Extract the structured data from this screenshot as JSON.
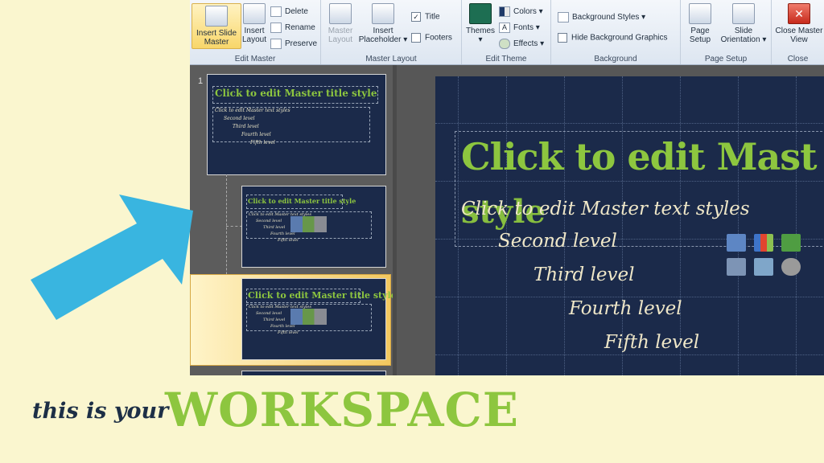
{
  "ribbon": {
    "groups": {
      "edit_master": "Edit Master",
      "master_layout": "Master Layout",
      "edit_theme": "Edit Theme",
      "background": "Background",
      "page_setup": "Page Setup",
      "close": "Close"
    },
    "insert_slide_master": "Insert Slide Master",
    "insert_layout": "Insert Layout",
    "delete": "Delete",
    "rename": "Rename",
    "preserve": "Preserve",
    "master_layout_btn": "Master Layout",
    "insert_placeholder": "Insert Placeholder",
    "title_chk": "Title",
    "footers_chk": "Footers",
    "themes": "Themes",
    "colors": "Colors",
    "fonts": "Fonts",
    "effects": "Effects",
    "background_styles": "Background Styles",
    "hide_background_graphics": "Hide Background Graphics",
    "page_setup_btn": "Page Setup",
    "slide_orientation": "Slide Orientation",
    "close_master_view": "Close Master View"
  },
  "thumbnails": {
    "number": "1",
    "master_title": "Click to edit Master title style",
    "text_lines": [
      "Click to edit Master text styles",
      "Second level",
      "Third level",
      "Fourth level",
      "Fifth level"
    ]
  },
  "slide": {
    "title_line1": "Click to edit Mast",
    "title_line2": "style",
    "levels": [
      "Click to edit Master text styles",
      "Second level",
      "Third level",
      "Fourth level",
      "Fifth level"
    ]
  },
  "caption": {
    "lead": "this is your",
    "emphasis": "WORKSPACE"
  },
  "colors": {
    "accent_green": "#8dc63f",
    "arrow_blue": "#39b5e0",
    "slide_navy": "#1b2a4a",
    "page_cream": "#faf6cf"
  }
}
